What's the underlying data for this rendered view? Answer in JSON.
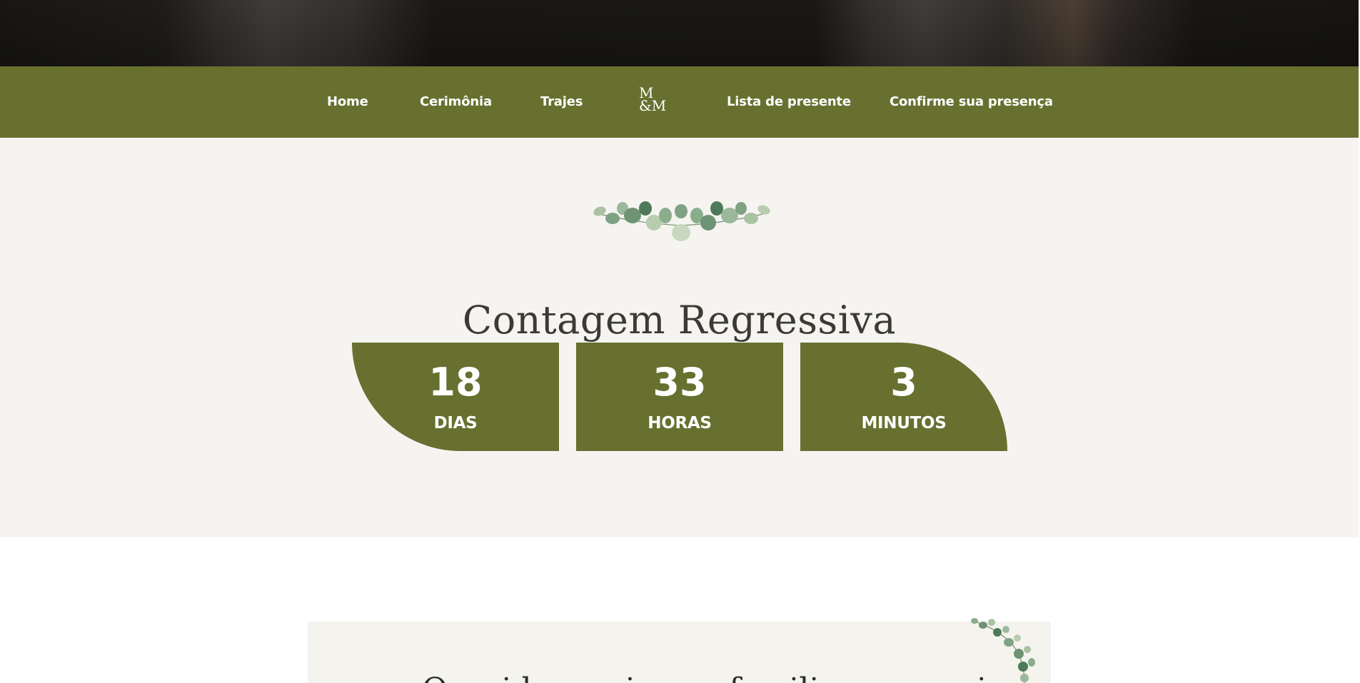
{
  "nav": {
    "items": [
      {
        "label": "Home"
      },
      {
        "label": "Cerimônia"
      },
      {
        "label": "Trajes"
      },
      {
        "label": "Lista de presente"
      },
      {
        "label": "Confirme sua presença"
      }
    ],
    "logo": {
      "line1": "M",
      "line2": "&M",
      "icon": "monogram-logo"
    }
  },
  "countdown": {
    "title": "Contagem Regressiva",
    "units": [
      {
        "value": "18",
        "label": "DIAS"
      },
      {
        "value": "33",
        "label": "HORAS"
      },
      {
        "value": "3",
        "label": "MINUTOS"
      }
    ]
  },
  "next_section": {
    "heading_partial": "Queridos amigos e familiares, que jo"
  },
  "colors": {
    "accent": "#67702f",
    "section_bg": "#f5f4f1",
    "title_text": "#3b3b33"
  },
  "icons": [
    "eucalyptus-garland-icon",
    "eucalyptus-corner-icon"
  ]
}
